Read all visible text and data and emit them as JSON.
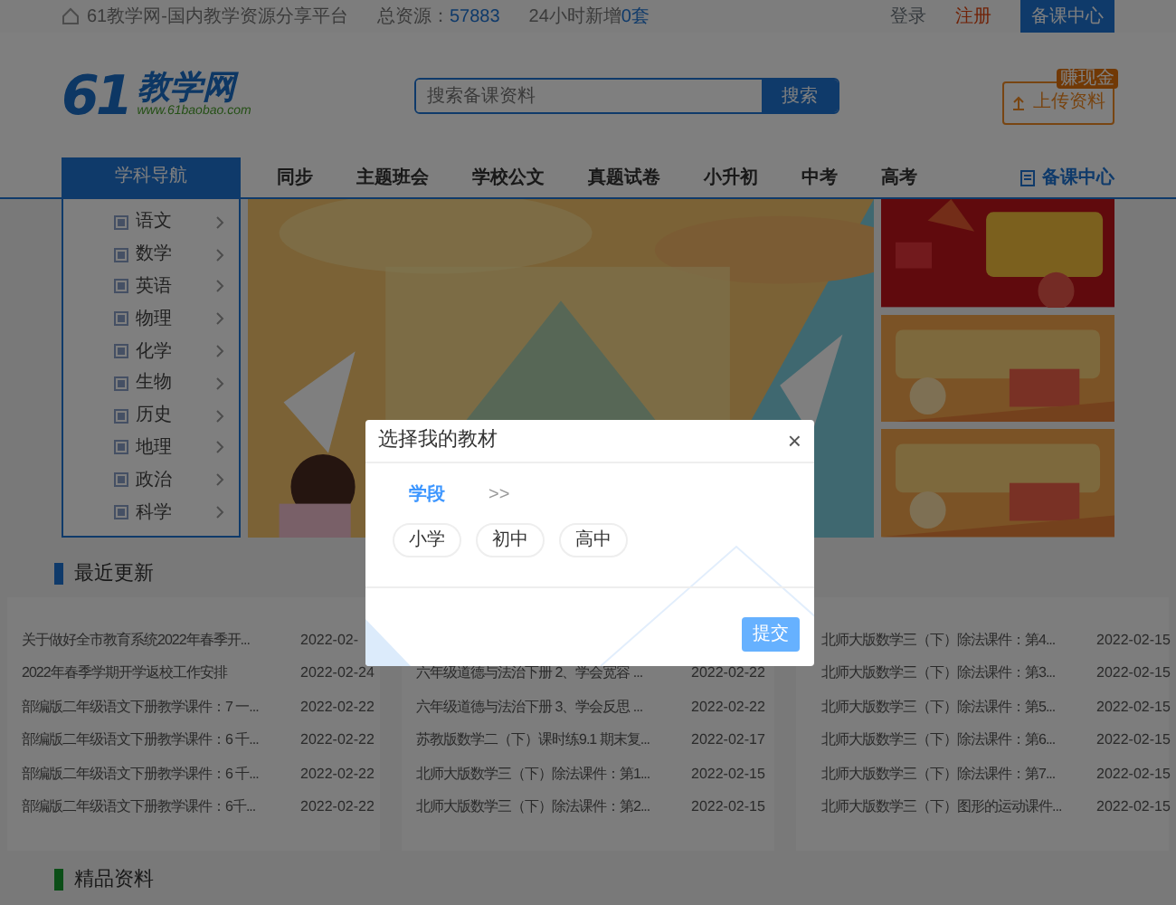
{
  "topbar": {
    "site_text": "61教学网-国内教学资源分享平台",
    "total_label": "总资源：",
    "total_value": "57883",
    "new_label": "24小时新增",
    "new_value": "0套",
    "login": "登录",
    "register": "注册",
    "center_button": "备课中心"
  },
  "header": {
    "logo_number": "61",
    "logo_name": "教学网",
    "logo_url": "www.61baobao.com",
    "search": {
      "placeholder": "搜索备课资料"
    },
    "search_button": "搜索",
    "upload_button": "上传资料",
    "upload_badge": "赚现金"
  },
  "nav": {
    "subject_title": "学科导航",
    "items": [
      "同步",
      "主题班会",
      "学校公文",
      "真题试卷",
      "小升初",
      "中考",
      "高考"
    ],
    "right_link": "备课中心"
  },
  "subjects": [
    "语文",
    "数学",
    "英语",
    "物理",
    "化学",
    "生物",
    "历史",
    "地理",
    "政治",
    "科学"
  ],
  "sections": [
    {
      "title": "最近更新",
      "color": "#0f3a6a",
      "columns": [
        [
          {
            "title": "关于做好全市教育系统2022年春季开...",
            "date": "2022-02-"
          },
          {
            "title": "2022年春季学期开学返校工作安排",
            "date": "2022-02-24"
          },
          {
            "title": "部编版二年级语文下册教学课件：7 一...",
            "date": "2022-02-22"
          },
          {
            "title": "部编版二年级语文下册教学课件：6 千...",
            "date": "2022-02-22"
          },
          {
            "title": "部编版二年级语文下册教学课件：6 千...",
            "date": "2022-02-22"
          },
          {
            "title": "部编版二年级语文下册教学课件：6千...",
            "date": "2022-02-22"
          }
        ],
        [
          {
            "title": "六年级道德与法治下册 2、学会宽容 ...",
            "date": "2022-02-22"
          },
          {
            "title": "六年级道德与法治下册 3、学会反思 ...",
            "date": "2022-02-22"
          },
          {
            "title": "苏教版数学二（下）课时练9.1 期末复...",
            "date": "2022-02-17"
          },
          {
            "title": "北师大版数学三（下）除法课件：第1...",
            "date": "2022-02-15"
          },
          {
            "title": "北师大版数学三（下）除法课件：第2...",
            "date": "2022-02-15"
          }
        ],
        [
          {
            "title": "北师大版数学三（下）除法课件：第4...",
            "date": "2022-02-15"
          },
          {
            "title": "北师大版数学三（下）除法课件：第3...",
            "date": "2022-02-15"
          },
          {
            "title": "北师大版数学三（下）除法课件：第5...",
            "date": "2022-02-15"
          },
          {
            "title": "北师大版数学三（下）除法课件：第6...",
            "date": "2022-02-15"
          },
          {
            "title": "北师大版数学三（下）除法课件：第7...",
            "date": "2022-02-15"
          },
          {
            "title": "北师大版数学三（下）图形的运动课件...",
            "date": "2022-02-15"
          }
        ]
      ]
    },
    {
      "title": "精品资料",
      "color": "#0b4e17"
    }
  ],
  "modal": {
    "title": "选择我的教材",
    "close": "×",
    "steps": [
      {
        "label": "学段",
        "selected": true
      }
    ],
    "step_separator": ">>",
    "options": [
      {
        "label": "小学",
        "selected": false
      },
      {
        "label": "初中",
        "selected": false
      },
      {
        "label": "高中",
        "selected": false
      }
    ],
    "submit": "提交"
  }
}
